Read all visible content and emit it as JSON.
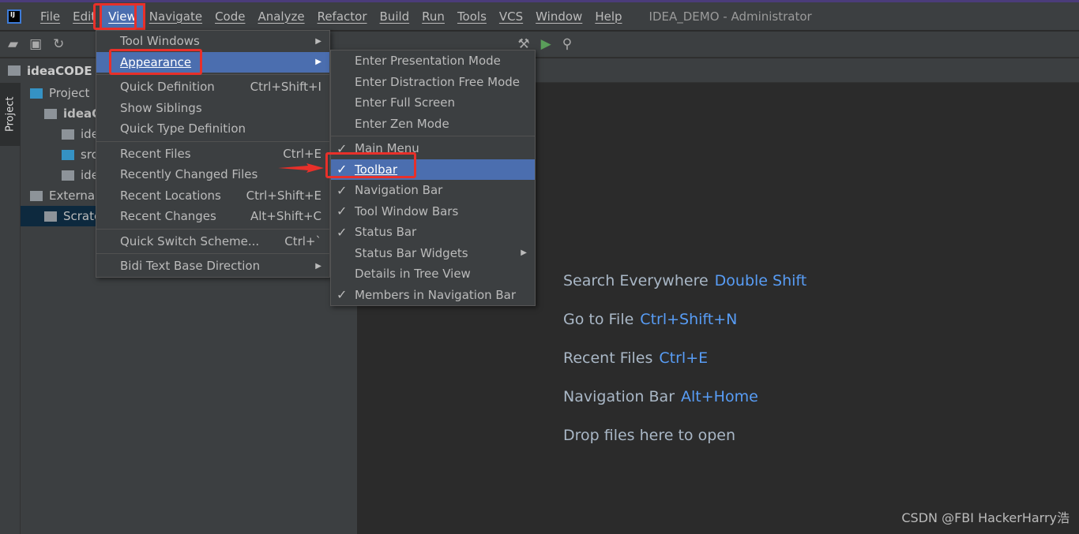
{
  "window": {
    "title": "IDEA_DEMO - Administrator"
  },
  "menubar": [
    "File",
    "Edit",
    "View",
    "Navigate",
    "Code",
    "Analyze",
    "Refactor",
    "Build",
    "Run",
    "Tools",
    "VCS",
    "Window",
    "Help"
  ],
  "navbar": {
    "project": "ideaCODE"
  },
  "project_panel": {
    "header": "Project",
    "items": [
      "ideaC",
      "idea",
      "src",
      "ide",
      "External Libraries",
      "Scratches"
    ]
  },
  "view_menu": [
    {
      "label": "Tool Windows",
      "submenu": true
    },
    {
      "label": "Appearance",
      "submenu": true,
      "highlighted": true
    },
    {
      "sep": true
    },
    {
      "label": "Quick Definition",
      "shortcut": "Ctrl+Shift+I"
    },
    {
      "label": "Show Siblings"
    },
    {
      "label": "Quick Type Definition"
    },
    {
      "sep": true
    },
    {
      "label": "Recent Files",
      "shortcut": "Ctrl+E"
    },
    {
      "label": "Recently Changed Files"
    },
    {
      "label": "Recent Locations",
      "shortcut": "Ctrl+Shift+E"
    },
    {
      "label": "Recent Changes",
      "shortcut": "Alt+Shift+C"
    },
    {
      "sep": true
    },
    {
      "label": "Quick Switch Scheme...",
      "shortcut": "Ctrl+`"
    },
    {
      "sep": true
    },
    {
      "label": "Bidi Text Base Direction",
      "submenu": true
    }
  ],
  "appearance_menu": [
    {
      "label": "Enter Presentation Mode"
    },
    {
      "label": "Enter Distraction Free Mode"
    },
    {
      "label": "Enter Full Screen"
    },
    {
      "label": "Enter Zen Mode"
    },
    {
      "sep": true
    },
    {
      "label": "Main Menu",
      "checked": true
    },
    {
      "label": "Toolbar",
      "checked": true,
      "highlighted": true
    },
    {
      "label": "Navigation Bar",
      "checked": true
    },
    {
      "label": "Tool Window Bars",
      "checked": true
    },
    {
      "label": "Status Bar",
      "checked": true
    },
    {
      "label": "Status Bar Widgets",
      "submenu": true
    },
    {
      "label": "Details in Tree View"
    },
    {
      "label": "Members in Navigation Bar",
      "checked": true
    }
  ],
  "editor_hints": [
    {
      "text": "Search Everywhere",
      "key": "Double Shift"
    },
    {
      "text": "Go to File",
      "key": "Ctrl+Shift+N"
    },
    {
      "text": "Recent Files",
      "key": "Ctrl+E"
    },
    {
      "text": "Navigation Bar",
      "key": "Alt+Home"
    },
    {
      "text": "Drop files here to open",
      "key": ""
    }
  ],
  "watermark": "CSDN @FBI HackerHarry浩",
  "stripe_tab": "Project",
  "colors": {
    "highlight": "#4b6eaf",
    "annotation": "#e8302a",
    "shortcut": "#589df6"
  }
}
